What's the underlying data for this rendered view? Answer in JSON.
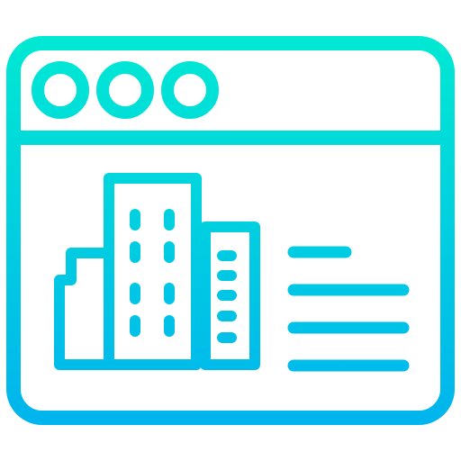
{
  "icon": {
    "name": "browser-window-building-icon",
    "gradient": {
      "top_color": "#00e9d3",
      "bottom_color": "#00b4ee"
    },
    "window_control_count": 3,
    "building_window_rows": 4,
    "side_building_window_rows": 5,
    "text_line_count": 4
  }
}
